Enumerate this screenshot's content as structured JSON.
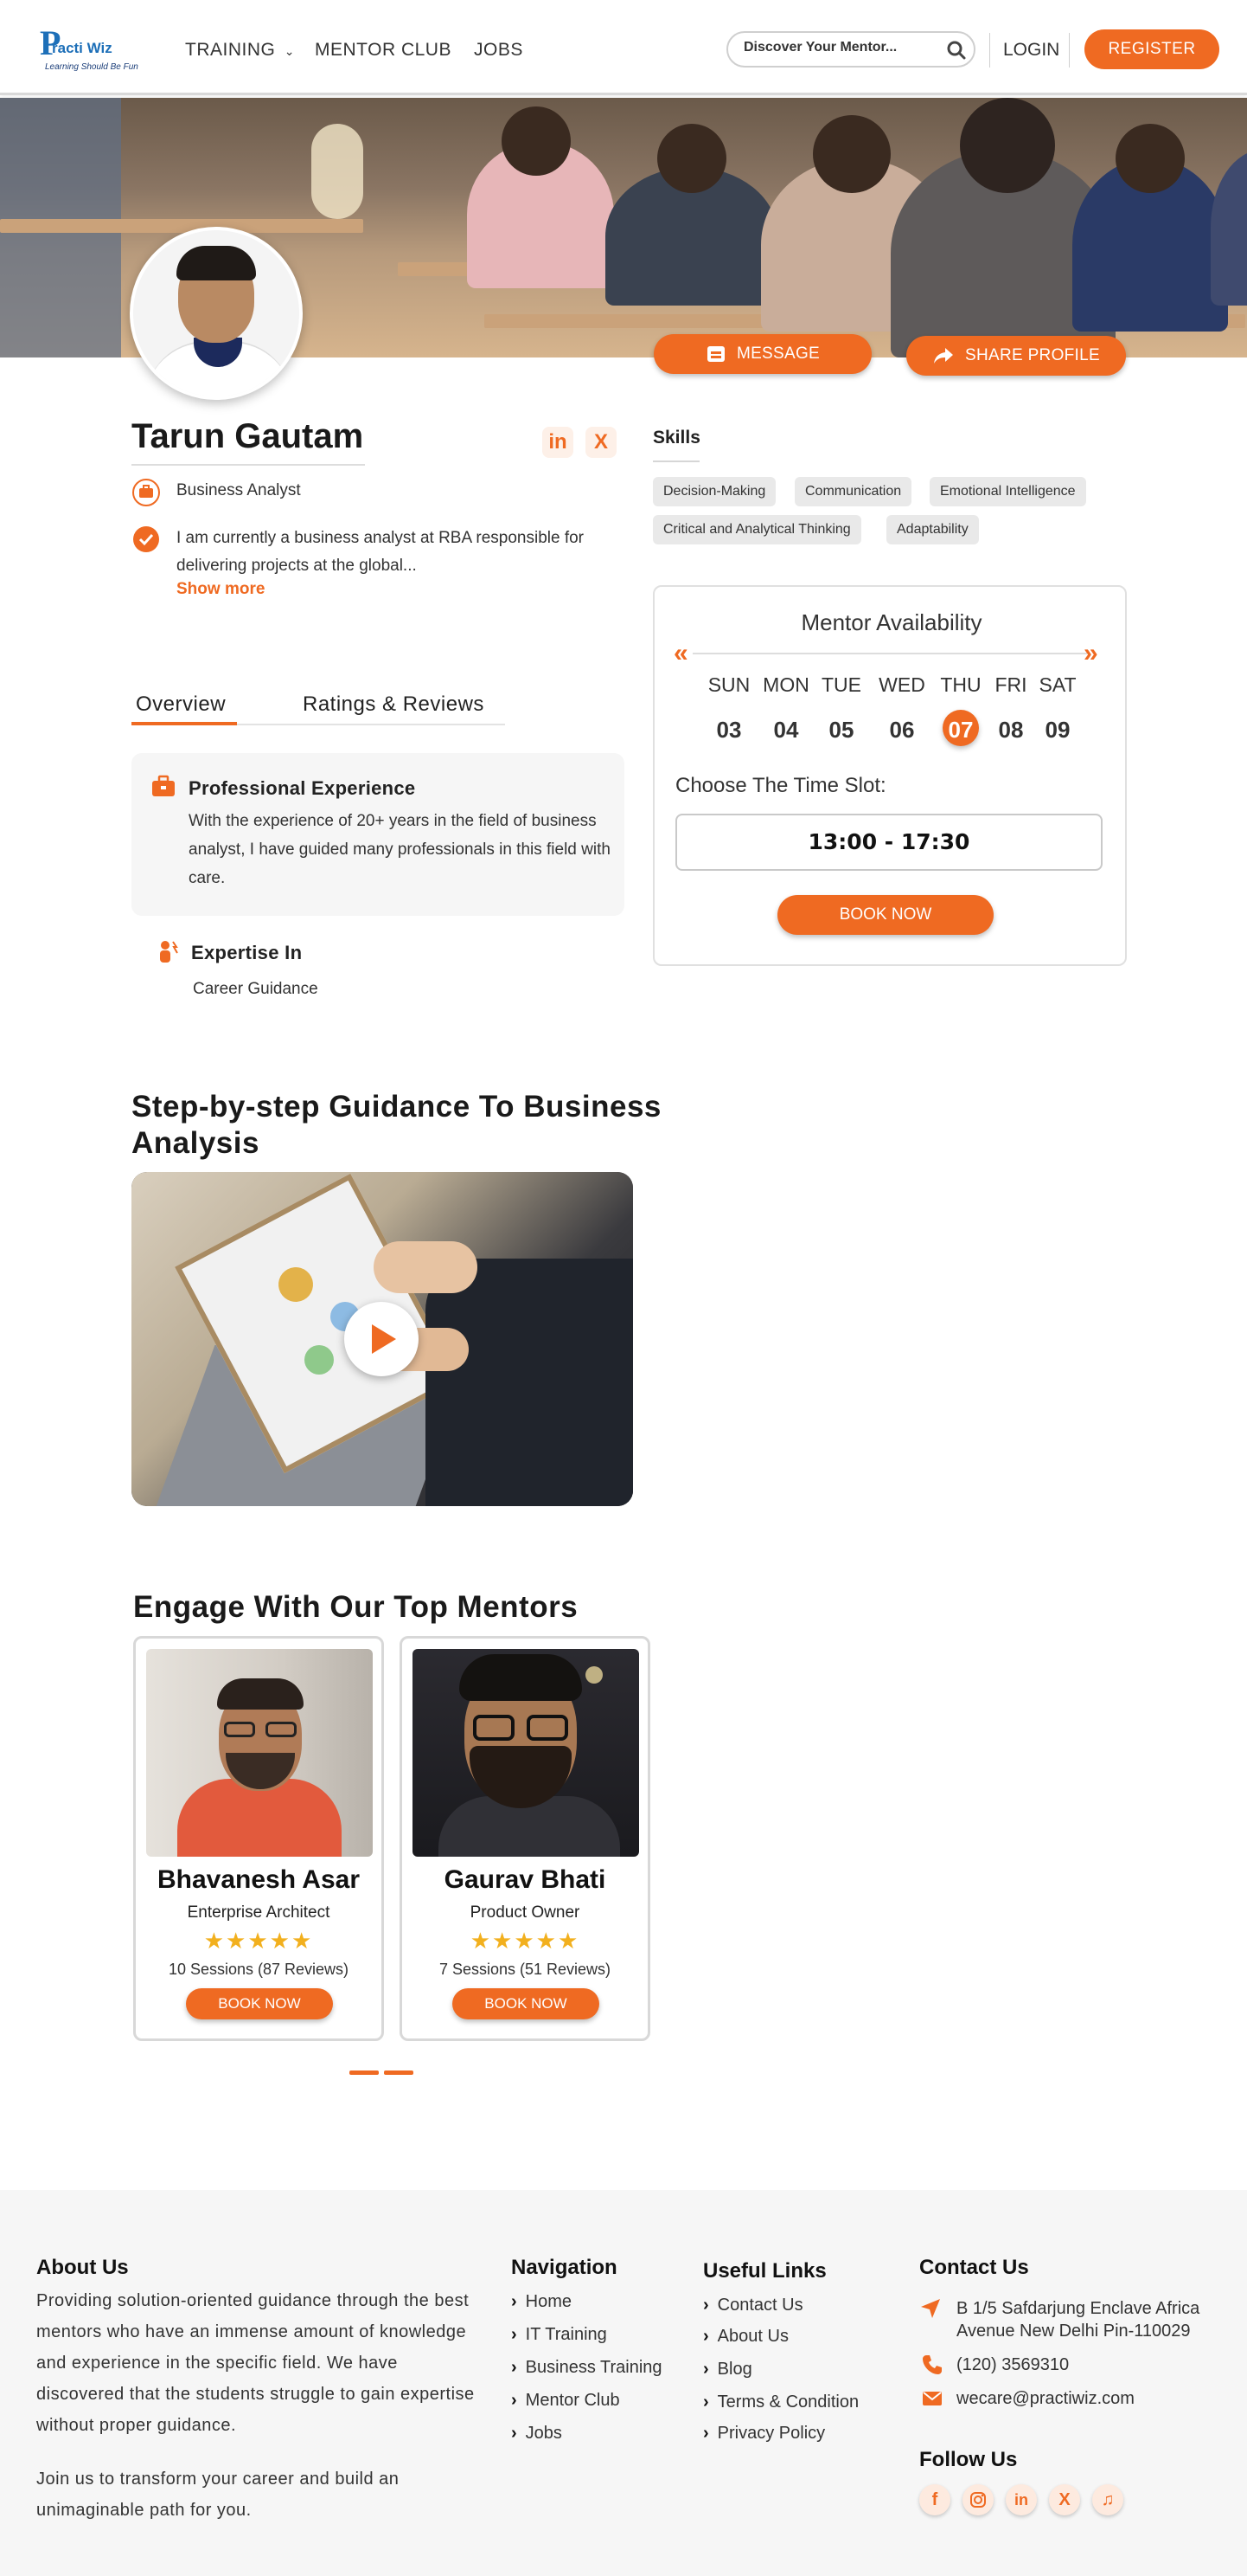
{
  "header": {
    "logo_text": "racti Wiz",
    "logo_tagline": "Learning Should Be Fun",
    "nav": [
      "TRAINING",
      "MENTOR CLUB",
      "JOBS"
    ],
    "search_placeholder": "Discover Your Mentor...",
    "login": "LOGIN",
    "register": "REGISTER"
  },
  "profile": {
    "name": "Tarun Gautam",
    "role": "Business Analyst",
    "bio": "I am currently a business analyst at RBA responsible for delivering projects at the global...",
    "show_more": "Show more",
    "message_button": "MESSAGE",
    "share_button": "SHARE PROFILE",
    "social": [
      "in",
      "X"
    ]
  },
  "skills": {
    "title": "Skills",
    "items": [
      "Decision-Making",
      "Communication",
      "Emotional Intelligence",
      "Critical and Analytical Thinking",
      "Adaptability"
    ]
  },
  "tabs": {
    "overview": "Overview",
    "ratings": "Ratings & Reviews"
  },
  "experience": {
    "title": "Professional Experience",
    "body": "With the experience of 20+ years in the field of business analyst, I have guided many professionals in this field with care."
  },
  "expertise": {
    "title": "Expertise In",
    "body": "Career Guidance"
  },
  "availability": {
    "title": "Mentor Availability",
    "days": [
      "SUN",
      "MON",
      "TUE",
      "WED",
      "THU",
      "FRI",
      "SAT"
    ],
    "dates": [
      "03",
      "04",
      "05",
      "06",
      "07",
      "08",
      "09"
    ],
    "selected_index": 4,
    "slot_label": "Choose The Time Slot:",
    "slot": "13:00  -  17:30",
    "book_now": "BOOK NOW"
  },
  "video_section": {
    "title_line1": "Step-by-step Guidance To Business",
    "title_line2": "Analysis"
  },
  "mentors_section": {
    "title": "Engage With Our Top Mentors",
    "mentors": [
      {
        "name": "Bhavanesh Asar",
        "role": "Enterprise Architect",
        "stars": "★★★★★",
        "sessions": "10 Sessions (87 Reviews)",
        "book": "BOOK NOW"
      },
      {
        "name": "Gaurav Bhati",
        "role": "Product Owner",
        "stars": "★★★★★",
        "sessions": "7 Sessions (51 Reviews)",
        "book": "BOOK NOW"
      }
    ]
  },
  "footer": {
    "about_title": "About Us",
    "about_text": "Providing solution-oriented guidance through the best mentors who have an immense amount of knowledge and experience in the specific field. We have discovered that the students struggle to gain expertise without proper guidance.",
    "about_text2": "Join us to transform your career and build an unimaginable path for you.",
    "nav_title": "Navigation",
    "nav_links": [
      "Home",
      "IT Training",
      "Business Training",
      "Mentor Club",
      "Jobs"
    ],
    "useful_title": "Useful Links",
    "useful_links": [
      "Contact Us",
      "About Us",
      "Blog",
      "Terms & Condition",
      "Privacy Policy"
    ],
    "contact_title": "Contact Us",
    "address_line1": "B 1/5 Safdarjung Enclave Africa",
    "address_line2": "Avenue New Delhi Pin-110029",
    "phone": "(120) 3569310",
    "email": "wecare@practiwiz.com",
    "follow_title": "Follow Us",
    "follow_icons": [
      "facebook-icon",
      "instagram-icon",
      "linkedin-icon",
      "x-icon",
      "tiktok-icon"
    ]
  },
  "colors": {
    "accent": "#ef6a22",
    "brand": "#1d6fb8",
    "star": "#f2b01e"
  }
}
